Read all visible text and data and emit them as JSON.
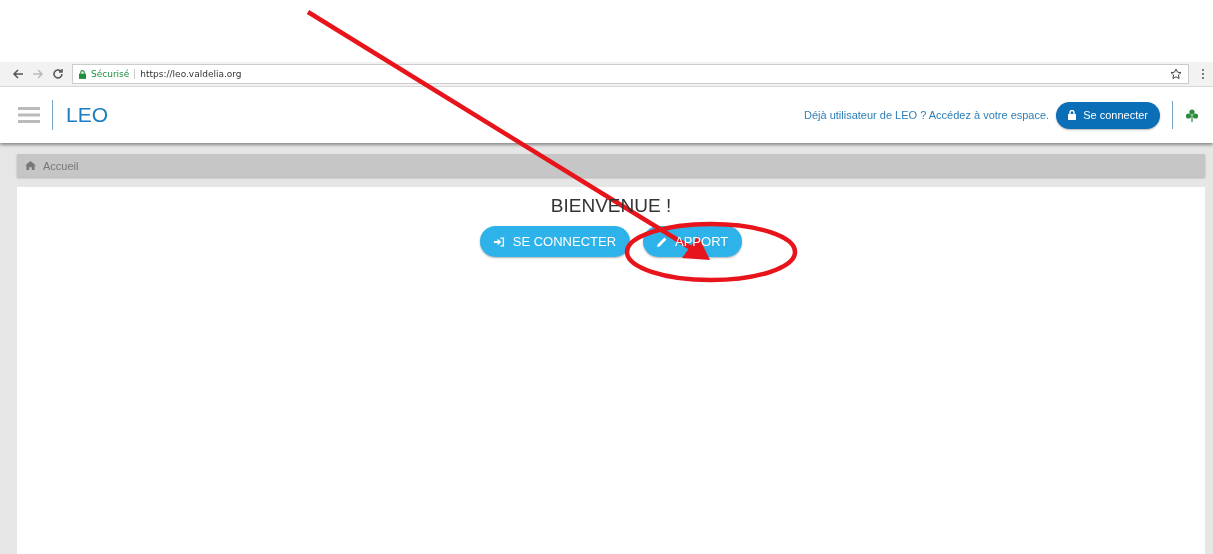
{
  "browser": {
    "security_label": "Sécurisé",
    "url": "https://leo.valdelia.org"
  },
  "header": {
    "logo": "LEO",
    "prompt": "Déjà utilisateur de LEO ? Accédez à votre espace.",
    "login_button": "Se connecter"
  },
  "breadcrumb": [
    "Accueil"
  ],
  "content": {
    "title": "BIENVENUE !",
    "buttons": [
      {
        "label": "SE CONNECTER",
        "kind": "login"
      },
      {
        "label": "APPORT",
        "kind": "edit"
      }
    ]
  },
  "annotation": {
    "kind": "arrow-circle"
  }
}
